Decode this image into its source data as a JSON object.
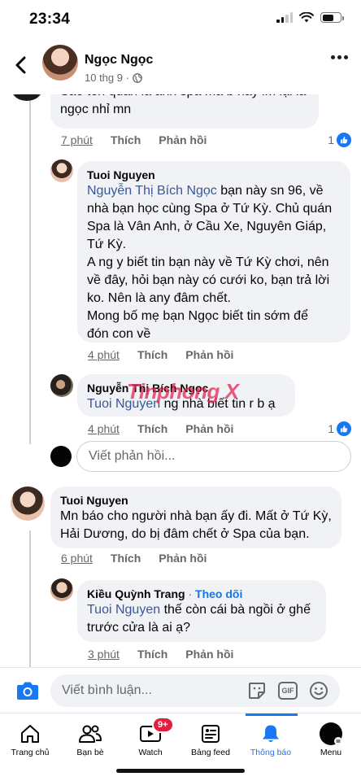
{
  "status_bar": {
    "time": "23:34"
  },
  "header": {
    "name": "Ngọc Ngọc",
    "meta": "10 thg 9 ·"
  },
  "comments": {
    "top": {
      "text_line1": "Sao tên quán là anh spa mà b hay im lại là",
      "text_line2": "ngọc nhỉ mn",
      "time": "7 phút",
      "like": "Thích",
      "reply": "Phản hồi",
      "reactions": "1"
    },
    "reply1": {
      "name": "Tuoi Nguyen",
      "mention": "Nguyễn Thị Bích Ngọc",
      "lines": [
        " bạn này sn 96, về",
        "nhà bạn học cùng Spa ở Tứ Kỳ. Chủ quán",
        "Spa là Vân Anh, ở Cầu Xe, Nguyên Giáp,",
        "Tứ Kỳ.",
        "A ng y biết tin bạn này về Tứ Kỳ chơi, nên",
        "về đây, hỏi bạn này có cưới ko, bạn trả lời",
        "ko. Nên là any đâm chết.",
        "Mong bố mẹ bạn Ngọc biết tin sớm để",
        "đón con về"
      ],
      "time": "4 phút",
      "like": "Thích",
      "reply": "Phản hồi"
    },
    "reply2": {
      "name": "Nguyễn Thị Bích Ngọc",
      "mention": "Tuoi Nguyen",
      "text": " ng nhà biết tin r b ạ",
      "time": "4 phút",
      "like": "Thích",
      "reply": "Phản hồi",
      "reactions": "1"
    },
    "reply_input": {
      "placeholder": "Viết phản hồi..."
    },
    "comment2": {
      "name": "Tuoi Nguyen",
      "line1": "Mn báo cho người nhà bạn ấy đi. Mất ở Tứ Kỳ,",
      "line2": "Hải Dương, do bị đâm chết ở Spa của bạn.",
      "time": "6 phút",
      "like": "Thích",
      "reply": "Phản hồi"
    },
    "reply3": {
      "name": "Kiều Quỳnh Trang",
      "sep": " · ",
      "follow": "Theo dõi",
      "mention": "Tuoi Nguyen",
      "line1": " thế còn cái bà ngồi ở ghế",
      "line2": "trước cửa là ai ạ?",
      "time": "3 phút",
      "like": "Thích",
      "reply": "Phản hồi"
    }
  },
  "watermark": "Tinphong X",
  "composer": {
    "placeholder": "Viết bình luận..."
  },
  "tabs": [
    {
      "label": "Trang chủ",
      "icon": "home-icon"
    },
    {
      "label": "Bạn bè",
      "icon": "friends-icon"
    },
    {
      "label": "Watch",
      "icon": "watch-icon",
      "badge": "9+"
    },
    {
      "label": "Bảng feed",
      "icon": "feed-icon"
    },
    {
      "label": "Thông báo",
      "icon": "bell-icon",
      "active": true
    },
    {
      "label": "Menu",
      "icon": "menu-avatar-icon"
    }
  ],
  "colors": {
    "accent": "#1877f2",
    "mention": "#385898",
    "bubble": "#f0f2f5",
    "badge": "#e41e3f"
  }
}
